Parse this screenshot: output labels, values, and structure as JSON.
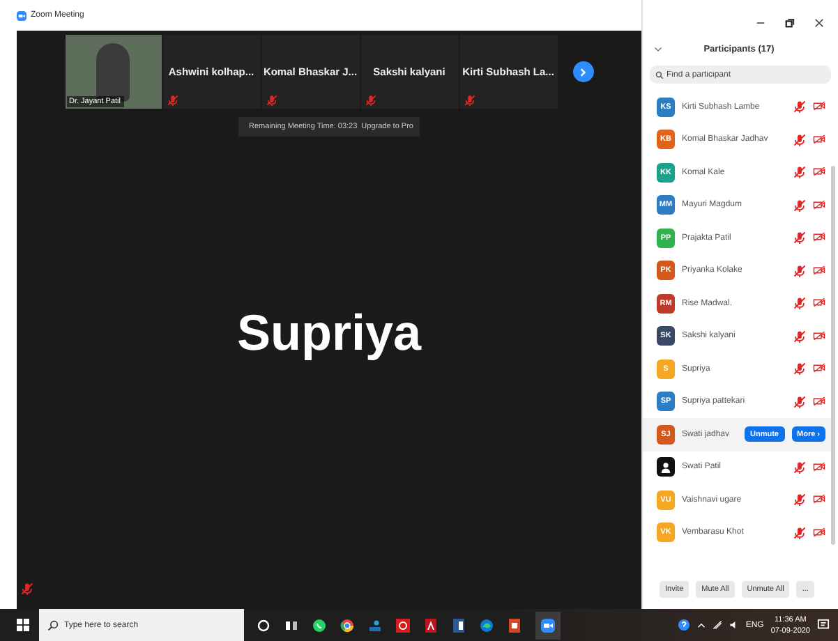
{
  "window": {
    "title": "Zoom Meeting"
  },
  "video_strip": {
    "tiles": [
      {
        "kind": "video",
        "name": "Dr. Jayant Patil",
        "muted": false
      },
      {
        "kind": "name",
        "name": "Ashwini  kolhap...",
        "muted": true
      },
      {
        "kind": "name",
        "name": "Komal Bhaskar J...",
        "muted": true
      },
      {
        "kind": "name",
        "name": "Sakshi kalyani",
        "muted": true
      },
      {
        "kind": "name",
        "name": "Kirti Subhash La...",
        "muted": true
      }
    ]
  },
  "banner": {
    "text": "Remaining Meeting Time: 03:23",
    "link": "Upgrade to Pro"
  },
  "active_speaker": {
    "name": "Supriya",
    "muted": true
  },
  "participants_panel": {
    "title": "Participants (17)",
    "search": {
      "placeholder": "Find a participant"
    },
    "participants": [
      {
        "kind": "initials",
        "initials": "KS",
        "name": "Kirti Subhash Lambe",
        "color": "#2d7dc4",
        "muted": true,
        "selected": false
      },
      {
        "kind": "initials",
        "initials": "KB",
        "name": "Komal Bhaskar Jadhav",
        "color": "#e0641a",
        "muted": true,
        "selected": false
      },
      {
        "kind": "initials",
        "initials": "KK",
        "name": "Komal Kale",
        "color": "#1aa38a",
        "muted": true,
        "selected": false
      },
      {
        "kind": "initials",
        "initials": "MM",
        "name": "Mayuri Magdum",
        "color": "#2d7dc4",
        "muted": true,
        "selected": false
      },
      {
        "kind": "initials",
        "initials": "PP",
        "name": "Prajakta Patil",
        "color": "#2fb34a",
        "muted": true,
        "selected": false
      },
      {
        "kind": "initials",
        "initials": "PK",
        "name": "Priyanka Kolake",
        "color": "#d4581a",
        "muted": true,
        "selected": false
      },
      {
        "kind": "initials",
        "initials": "RM",
        "name": "Rise Madwal.",
        "color": "#c0392b",
        "muted": true,
        "selected": false
      },
      {
        "kind": "initials",
        "initials": "SK",
        "name": "Sakshi kalyani",
        "color": "#3a4a66",
        "muted": true,
        "selected": false
      },
      {
        "kind": "initials",
        "initials": "S",
        "name": "Supriya",
        "color": "#f5a623",
        "muted": true,
        "selected": false
      },
      {
        "kind": "initials",
        "initials": "SP",
        "name": "Supriya pattekari",
        "color": "#2d7dc4",
        "muted": true,
        "selected": false
      },
      {
        "kind": "initials",
        "initials": "SJ",
        "name": "Swati jadhav",
        "color": "#d4581a",
        "selected": true
      },
      {
        "kind": "silhouette",
        "name": "Swati Patil",
        "color": "#111111",
        "muted": true,
        "selected": false
      },
      {
        "kind": "initials",
        "initials": "VU",
        "name": "Vaishnavi ugare",
        "color": "#f5a623",
        "muted": true,
        "selected": false
      },
      {
        "kind": "initials",
        "initials": "VK",
        "name": "Vembarasu Khot",
        "color": "#f5a623",
        "muted": true,
        "selected": false
      }
    ],
    "row_actions": [
      "Unmute",
      "More ›"
    ],
    "footer_buttons": [
      "Invite",
      "Mute All",
      "Unmute All",
      "..."
    ]
  },
  "taskbar": {
    "search": {
      "placeholder": "Type here to search"
    },
    "language": "ENG",
    "time": "11:36 AM",
    "date": "07-09-2020"
  }
}
